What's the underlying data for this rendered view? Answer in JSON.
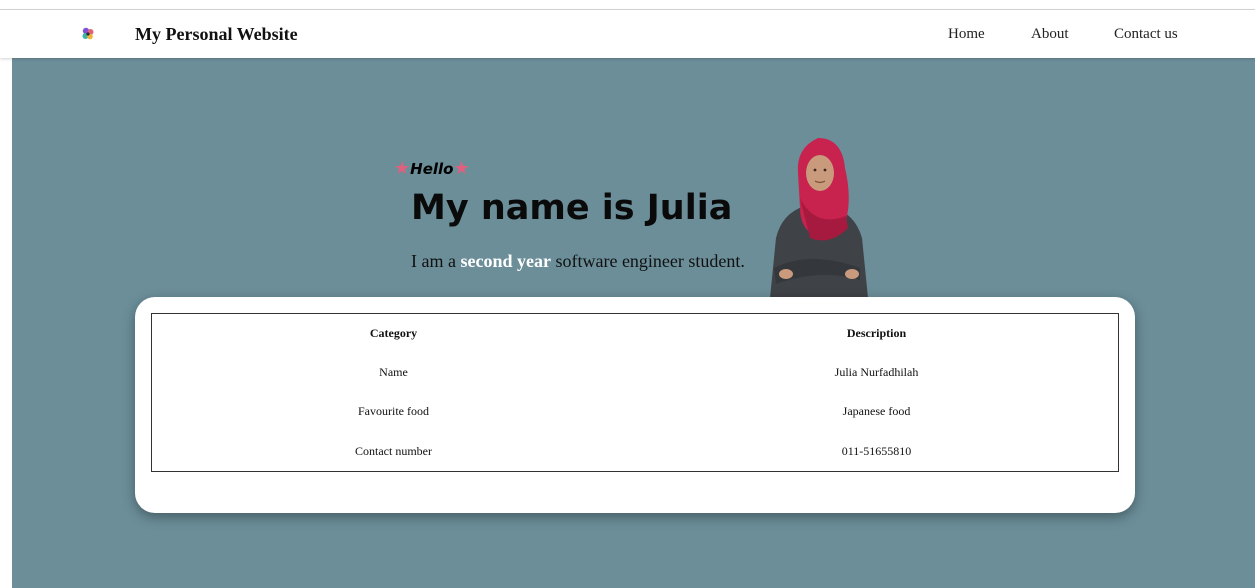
{
  "navbar": {
    "title": "My Personal Website",
    "links": [
      "Home",
      "About",
      "Contact us"
    ],
    "logo_icon": "flower-icon"
  },
  "hero": {
    "greeting": "Hello",
    "greeting_icon": "star-icon",
    "headline": "My name is Julia",
    "tagline_prefix": "I am a ",
    "tagline_emphasis": "second year",
    "tagline_suffix": " software engineer student.",
    "background_color": "#6b8e99",
    "star_color": "#e0607e"
  },
  "info_table": {
    "headers": [
      "Category",
      "Description"
    ],
    "rows": [
      [
        "Name",
        "Julia Nurfadhilah"
      ],
      [
        "Favourite food",
        "Japanese food"
      ],
      [
        "Contact number",
        "011-51655810"
      ]
    ]
  }
}
